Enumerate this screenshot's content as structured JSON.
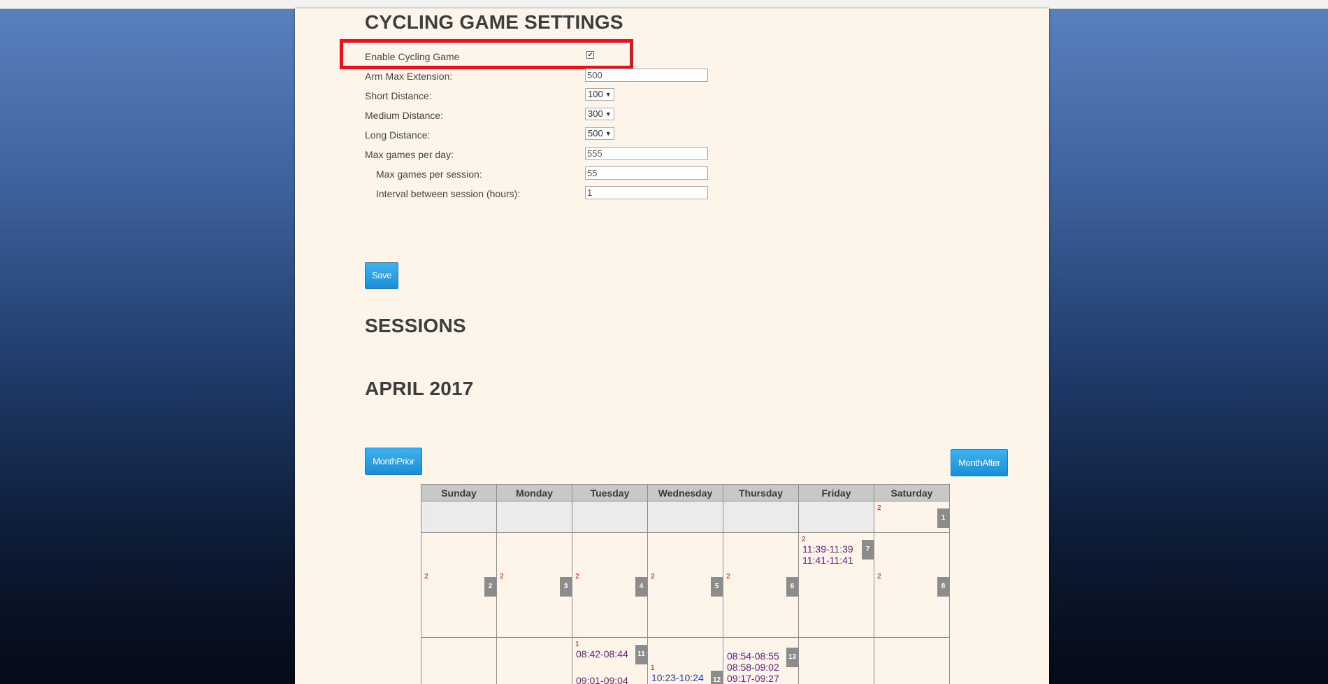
{
  "settings": {
    "title": "CYCLING GAME SETTINGS",
    "enable_label": "Enable Cycling Game",
    "enable_checked": true,
    "arm_label": "Arm Max Extension:",
    "arm_value": "500",
    "short_label": "Short Distance:",
    "short_value": "100",
    "medium_label": "Medium Distance:",
    "medium_value": "300",
    "long_label": "Long Distance:",
    "long_value": "500",
    "max_day_label": "Max games per day:",
    "max_day_value": "555",
    "max_session_label": "Max games per session:",
    "max_session_value": "55",
    "interval_label": "Interval between session (hours):",
    "interval_value": "1",
    "save_label": "Save",
    "highlight_color": "#e3141f"
  },
  "sessions": {
    "title": "SESSIONS",
    "month_title": "APRIL 2017",
    "prior_label": "MonthPrior",
    "after_label": "MonthAfter"
  },
  "calendar": {
    "days": [
      "Sunday",
      "Monday",
      "Tuesday",
      "Wednesday",
      "Thursday",
      "Friday",
      "Saturday"
    ],
    "row0": {
      "sat": {
        "count": "2",
        "day": "1"
      }
    },
    "row1": {
      "sun": {
        "count": "2",
        "day": "2"
      },
      "mon": {
        "count": "2",
        "day": "3"
      },
      "tue": {
        "count": "2",
        "day": "4"
      },
      "wed": {
        "count": "2",
        "day": "5"
      },
      "thu": {
        "count": "2",
        "day": "6"
      },
      "fri": {
        "count": "2",
        "day": "7",
        "s1": "11:39-11:39",
        "s2": "11:41-11:41"
      },
      "sat": {
        "count": "2",
        "day": "8"
      }
    },
    "row2": {
      "tue": {
        "count": "1",
        "day": "11",
        "s1": "08:42-08:44",
        "s2": "09:01-09:04"
      },
      "wed": {
        "count": "1",
        "day": "12",
        "s1": "10:23-10:24"
      },
      "thu": {
        "day": "13",
        "s1": "08:54-08:55",
        "s2": "08:58-09:02",
        "s3": "09:17-09:27"
      }
    }
  },
  "colors": {
    "button_blue": "#2a9fe3",
    "count_red": "#e00000",
    "session_purple": "#6a1e7e",
    "session_blue": "#1d3cc4",
    "page_bg": "#fdf5ea"
  }
}
